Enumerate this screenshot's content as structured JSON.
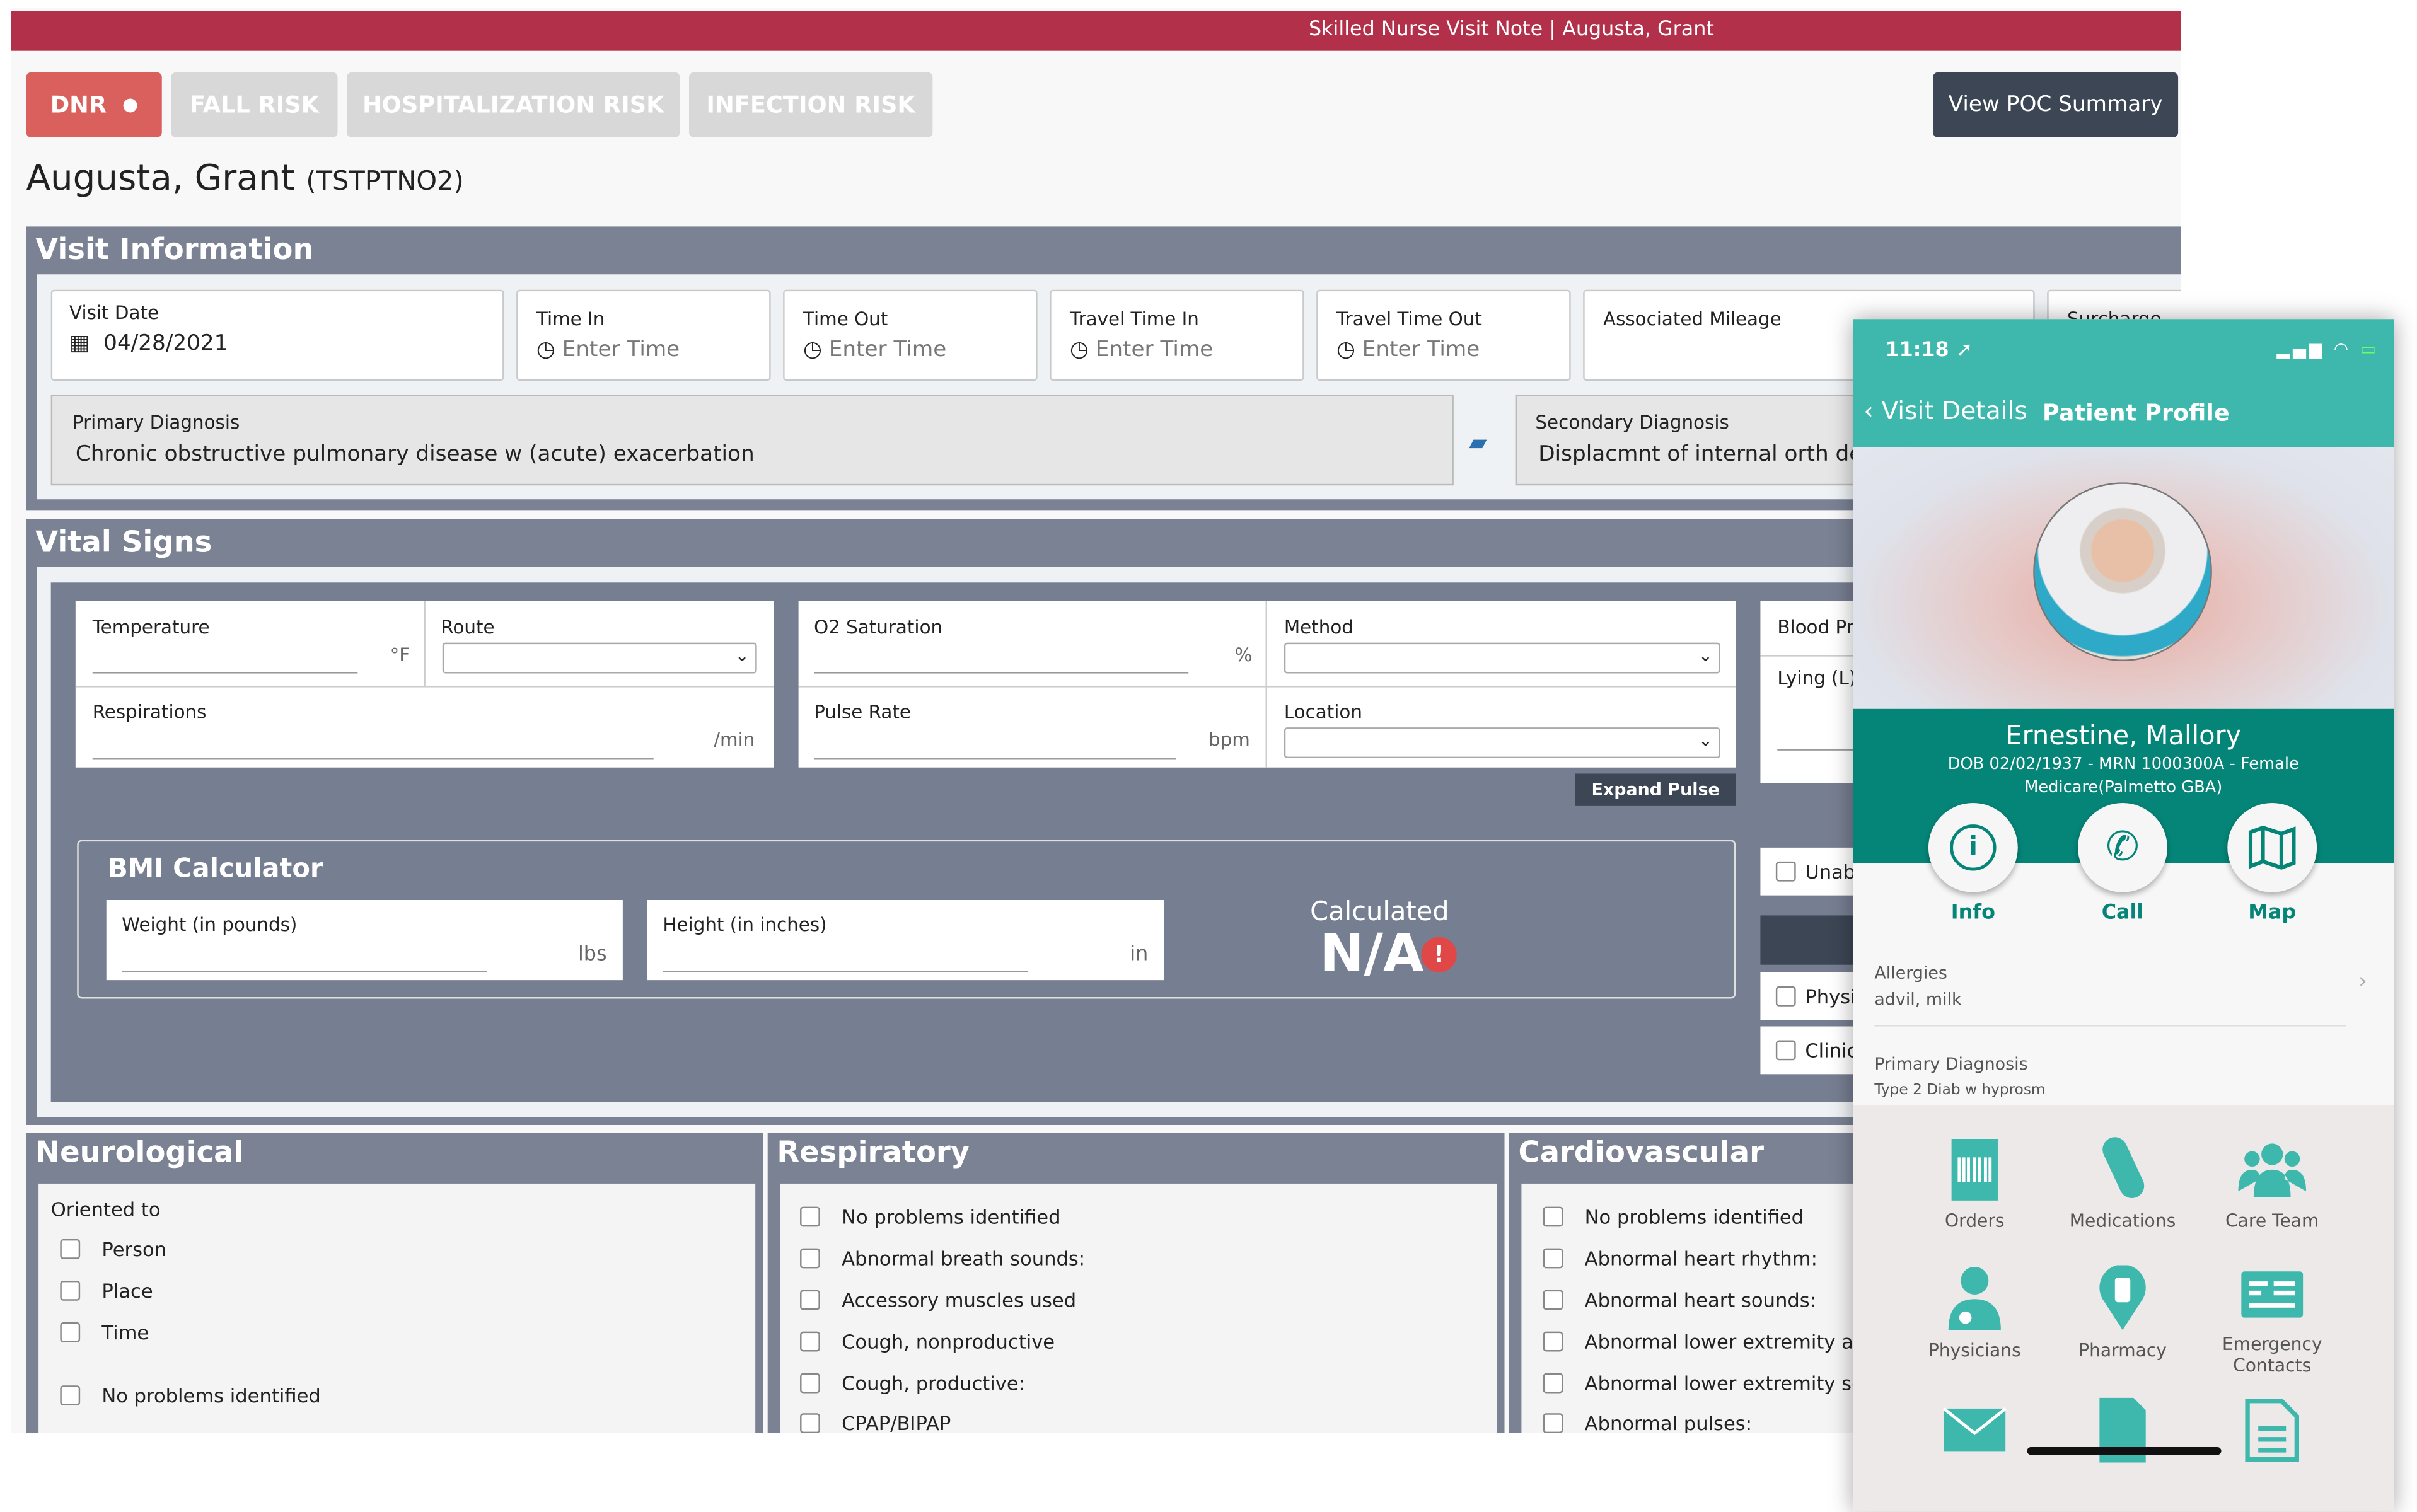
{
  "header": {
    "title": "Skilled Nurse Visit Note | Augusta, Grant"
  },
  "badges": [
    {
      "label": "DNR",
      "active": true
    },
    {
      "label": "FALL RISK",
      "active": false
    },
    {
      "label": "HOSPITALIZATION RISK",
      "active": false
    },
    {
      "label": "INFECTION RISK",
      "active": false
    }
  ],
  "poc_button": "View POC Summary",
  "patient": {
    "name": "Augusta, Grant",
    "id": "(TSTPTNO2)"
  },
  "visit_info": {
    "title": "Visit Information",
    "visit_date": {
      "label": "Visit Date",
      "value": "04/28/2021"
    },
    "time_in": {
      "label": "Time In",
      "placeholder": "Enter Time"
    },
    "time_out": {
      "label": "Time Out",
      "placeholder": "Enter Time"
    },
    "travel_in": {
      "label": "Travel Time In",
      "placeholder": "Enter Time"
    },
    "travel_out": {
      "label": "Travel Time Out",
      "placeholder": "Enter Time"
    },
    "mileage": {
      "label": "Associated Mileage"
    },
    "surcharge": {
      "label": "Surcharge"
    },
    "primary_dx": {
      "label": "Primary Diagnosis",
      "value": "Chronic obstructive pulmonary disease w (acute) exacerbation"
    },
    "secondary_dx": {
      "label": "Secondary Diagnosis",
      "value": "Displacmnt of internal orth dev"
    }
  },
  "vitals": {
    "title": "Vital Signs",
    "temperature": {
      "label": "Temperature",
      "unit": "°F"
    },
    "route": {
      "label": "Route"
    },
    "o2": {
      "label": "O2 Saturation",
      "unit": "%"
    },
    "method": {
      "label": "Method"
    },
    "respirations": {
      "label": "Respirations",
      "unit": "/min"
    },
    "pulse": {
      "label": "Pulse Rate",
      "unit": "bpm"
    },
    "location": {
      "label": "Location"
    },
    "expand_pulse": "Expand Pulse",
    "blood_pressure": {
      "label": "Blood Pr",
      "position": "Lying (L)"
    },
    "side_checks": [
      "Unab",
      "Physi",
      "Clinic"
    ],
    "bmi": {
      "title": "BMI Calculator",
      "weight": {
        "label": "Weight (in pounds)",
        "unit": "lbs"
      },
      "height": {
        "label": "Height (in inches)",
        "unit": "in"
      },
      "calc_label": "Calculated",
      "calc_value": "N/A"
    }
  },
  "neuro": {
    "title": "Neurological",
    "subtitle": "Oriented to",
    "items": [
      "Person",
      "Place",
      "Time",
      "No problems identified"
    ]
  },
  "resp": {
    "title": "Respiratory",
    "items": [
      "No problems identified",
      "Abnormal breath sounds:",
      "Accessory muscles used",
      "Cough, nonproductive",
      "Cough, productive:",
      "CPAP/BIPAP"
    ]
  },
  "cardio": {
    "title": "Cardiovascular",
    "items": [
      "No problems identified",
      "Abnormal heart rhythm:",
      "Abnormal heart sounds:",
      "Abnormal lower extremity app",
      "Abnormal lower extremity sen",
      "Abnormal pulses:"
    ]
  },
  "phone": {
    "time": "11:18",
    "back": "Visit Details",
    "title": "Patient Profile",
    "name": "Ernestine, Mallory",
    "details": "DOB 02/02/1937 - MRN 1000300A - Female",
    "payer": "Medicare(Palmetto GBA)",
    "actions": [
      "Info",
      "Call",
      "Map"
    ],
    "allergies": {
      "label": "Allergies",
      "value": "advil, milk"
    },
    "primary_dx": {
      "label": "Primary Diagnosis",
      "value": "Type 2 Diab w hyprosm"
    },
    "tiles": [
      "Orders",
      "Medications",
      "Care Team",
      "Physicians",
      "Pharmacy",
      "Emergency Contacts"
    ],
    "colors": {
      "teal": "#3eb8ad",
      "dark_teal": "#058578"
    }
  },
  "colors": {
    "header_red": "#b3304a",
    "dnr": "#d9605c",
    "section": "#7a8294"
  }
}
